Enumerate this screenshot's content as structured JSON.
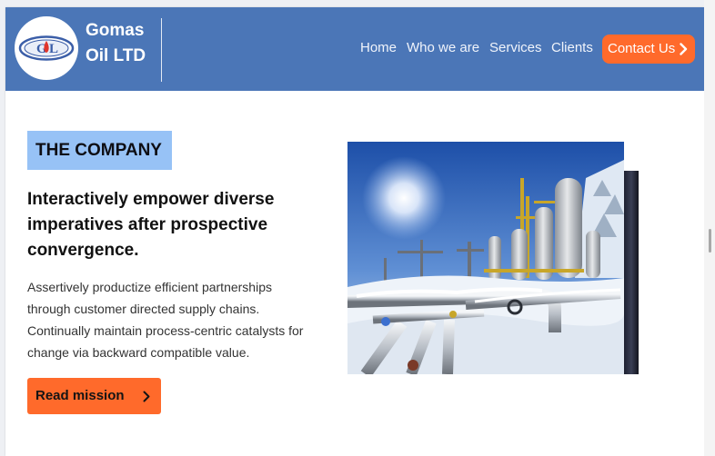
{
  "header": {
    "brand_line1": "Gomas",
    "brand_line2": "Oil LTD",
    "logo_text": "G L",
    "nav": [
      "Home",
      "Who we are",
      "Services",
      "Clients"
    ],
    "contact_label": "Contact Us"
  },
  "company": {
    "section_label": "THE COMPANY",
    "headline": "Interactively empower diverse imperatives after prospective convergence.",
    "body": "Assertively productize efficient partnerships through customer directed supply chains. Continually maintain process-centric catalysts for change via backward compatible value.",
    "button_label": "Read mission",
    "image_alt": "Snow-covered oil and gas processing plant with pipes and storage tanks"
  },
  "colors": {
    "header_bg": "#4b76b7",
    "accent_orange": "#ff6a2b",
    "label_bg": "#97c2f6"
  },
  "icons": [
    "logo-icon",
    "chevron-right-icon"
  ]
}
